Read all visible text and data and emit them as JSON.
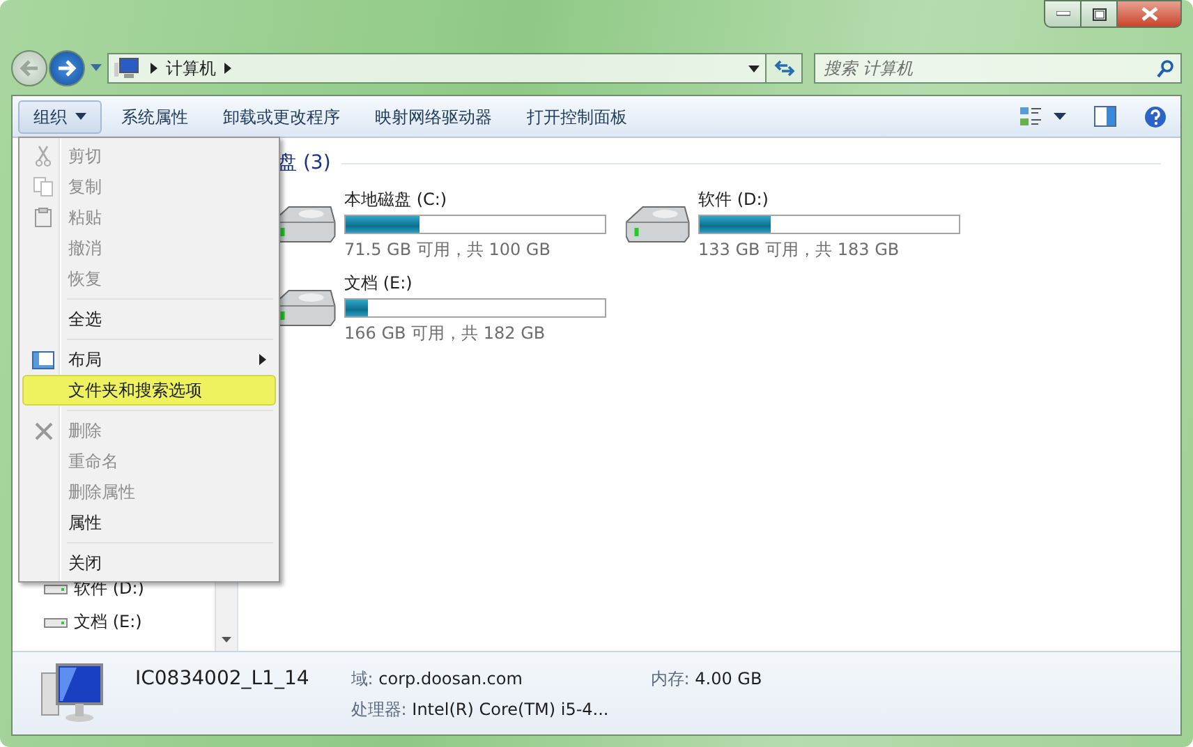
{
  "address": {
    "segments": [
      "计算机"
    ]
  },
  "search": {
    "placeholder": "搜索 计算机"
  },
  "toolbar": {
    "buttons": [
      {
        "label": "组织",
        "dropdown": true,
        "pressed": true
      },
      {
        "label": "系统属性",
        "dropdown": false,
        "pressed": false
      },
      {
        "label": "卸载或更改程序",
        "dropdown": false,
        "pressed": false
      },
      {
        "label": "映射网络驱动器",
        "dropdown": false,
        "pressed": false
      },
      {
        "label": "打开控制面板",
        "dropdown": false,
        "pressed": false
      }
    ]
  },
  "nav": {
    "items": [
      {
        "label": "软件 (D:)"
      },
      {
        "label": "文档 (E:)"
      }
    ]
  },
  "group": {
    "title": "盘 (3)"
  },
  "drives": [
    {
      "name": "本地磁盘 (C:)",
      "level": 0.285,
      "space": "71.5 GB 可用，共 100 GB"
    },
    {
      "name": "软件 (D:)",
      "level": 0.273,
      "space": "133 GB 可用，共 183 GB"
    },
    {
      "name": "文档 (E:)",
      "level": 0.088,
      "space": "166 GB 可用，共 182 GB"
    }
  ],
  "menu": [
    {
      "kind": "item",
      "label": "剪切",
      "disabled": true,
      "selected": false,
      "submenu": false
    },
    {
      "kind": "item",
      "label": "复制",
      "disabled": true,
      "selected": false,
      "submenu": false
    },
    {
      "kind": "item",
      "label": "粘贴",
      "disabled": true,
      "selected": false,
      "submenu": false
    },
    {
      "kind": "item",
      "label": "撤消",
      "disabled": true,
      "selected": false,
      "submenu": false
    },
    {
      "kind": "item",
      "label": "恢复",
      "disabled": true,
      "selected": false,
      "submenu": false
    },
    {
      "kind": "separator"
    },
    {
      "kind": "item",
      "label": "全选",
      "disabled": false,
      "selected": false,
      "submenu": false
    },
    {
      "kind": "separator"
    },
    {
      "kind": "item",
      "label": "布局",
      "disabled": false,
      "selected": false,
      "submenu": true
    },
    {
      "kind": "item",
      "label": "文件夹和搜索选项",
      "disabled": false,
      "selected": true,
      "submenu": false
    },
    {
      "kind": "separator"
    },
    {
      "kind": "item",
      "label": "删除",
      "disabled": true,
      "selected": false,
      "submenu": false
    },
    {
      "kind": "item",
      "label": "重命名",
      "disabled": true,
      "selected": false,
      "submenu": false
    },
    {
      "kind": "item",
      "label": "删除属性",
      "disabled": true,
      "selected": false,
      "submenu": false
    },
    {
      "kind": "item",
      "label": "属性",
      "disabled": false,
      "selected": false,
      "submenu": false
    },
    {
      "kind": "separator"
    },
    {
      "kind": "item",
      "label": "关闭",
      "disabled": false,
      "selected": false,
      "submenu": false
    }
  ],
  "details": {
    "computer_name": "IC0834002_L1_14",
    "fields": [
      {
        "label": "域:",
        "value": "corp.doosan.com"
      },
      {
        "label": "内存:",
        "value": "4.00 GB"
      },
      {
        "label": "处理器:",
        "value": "Intel(R) Core(TM) i5-4..."
      }
    ]
  }
}
